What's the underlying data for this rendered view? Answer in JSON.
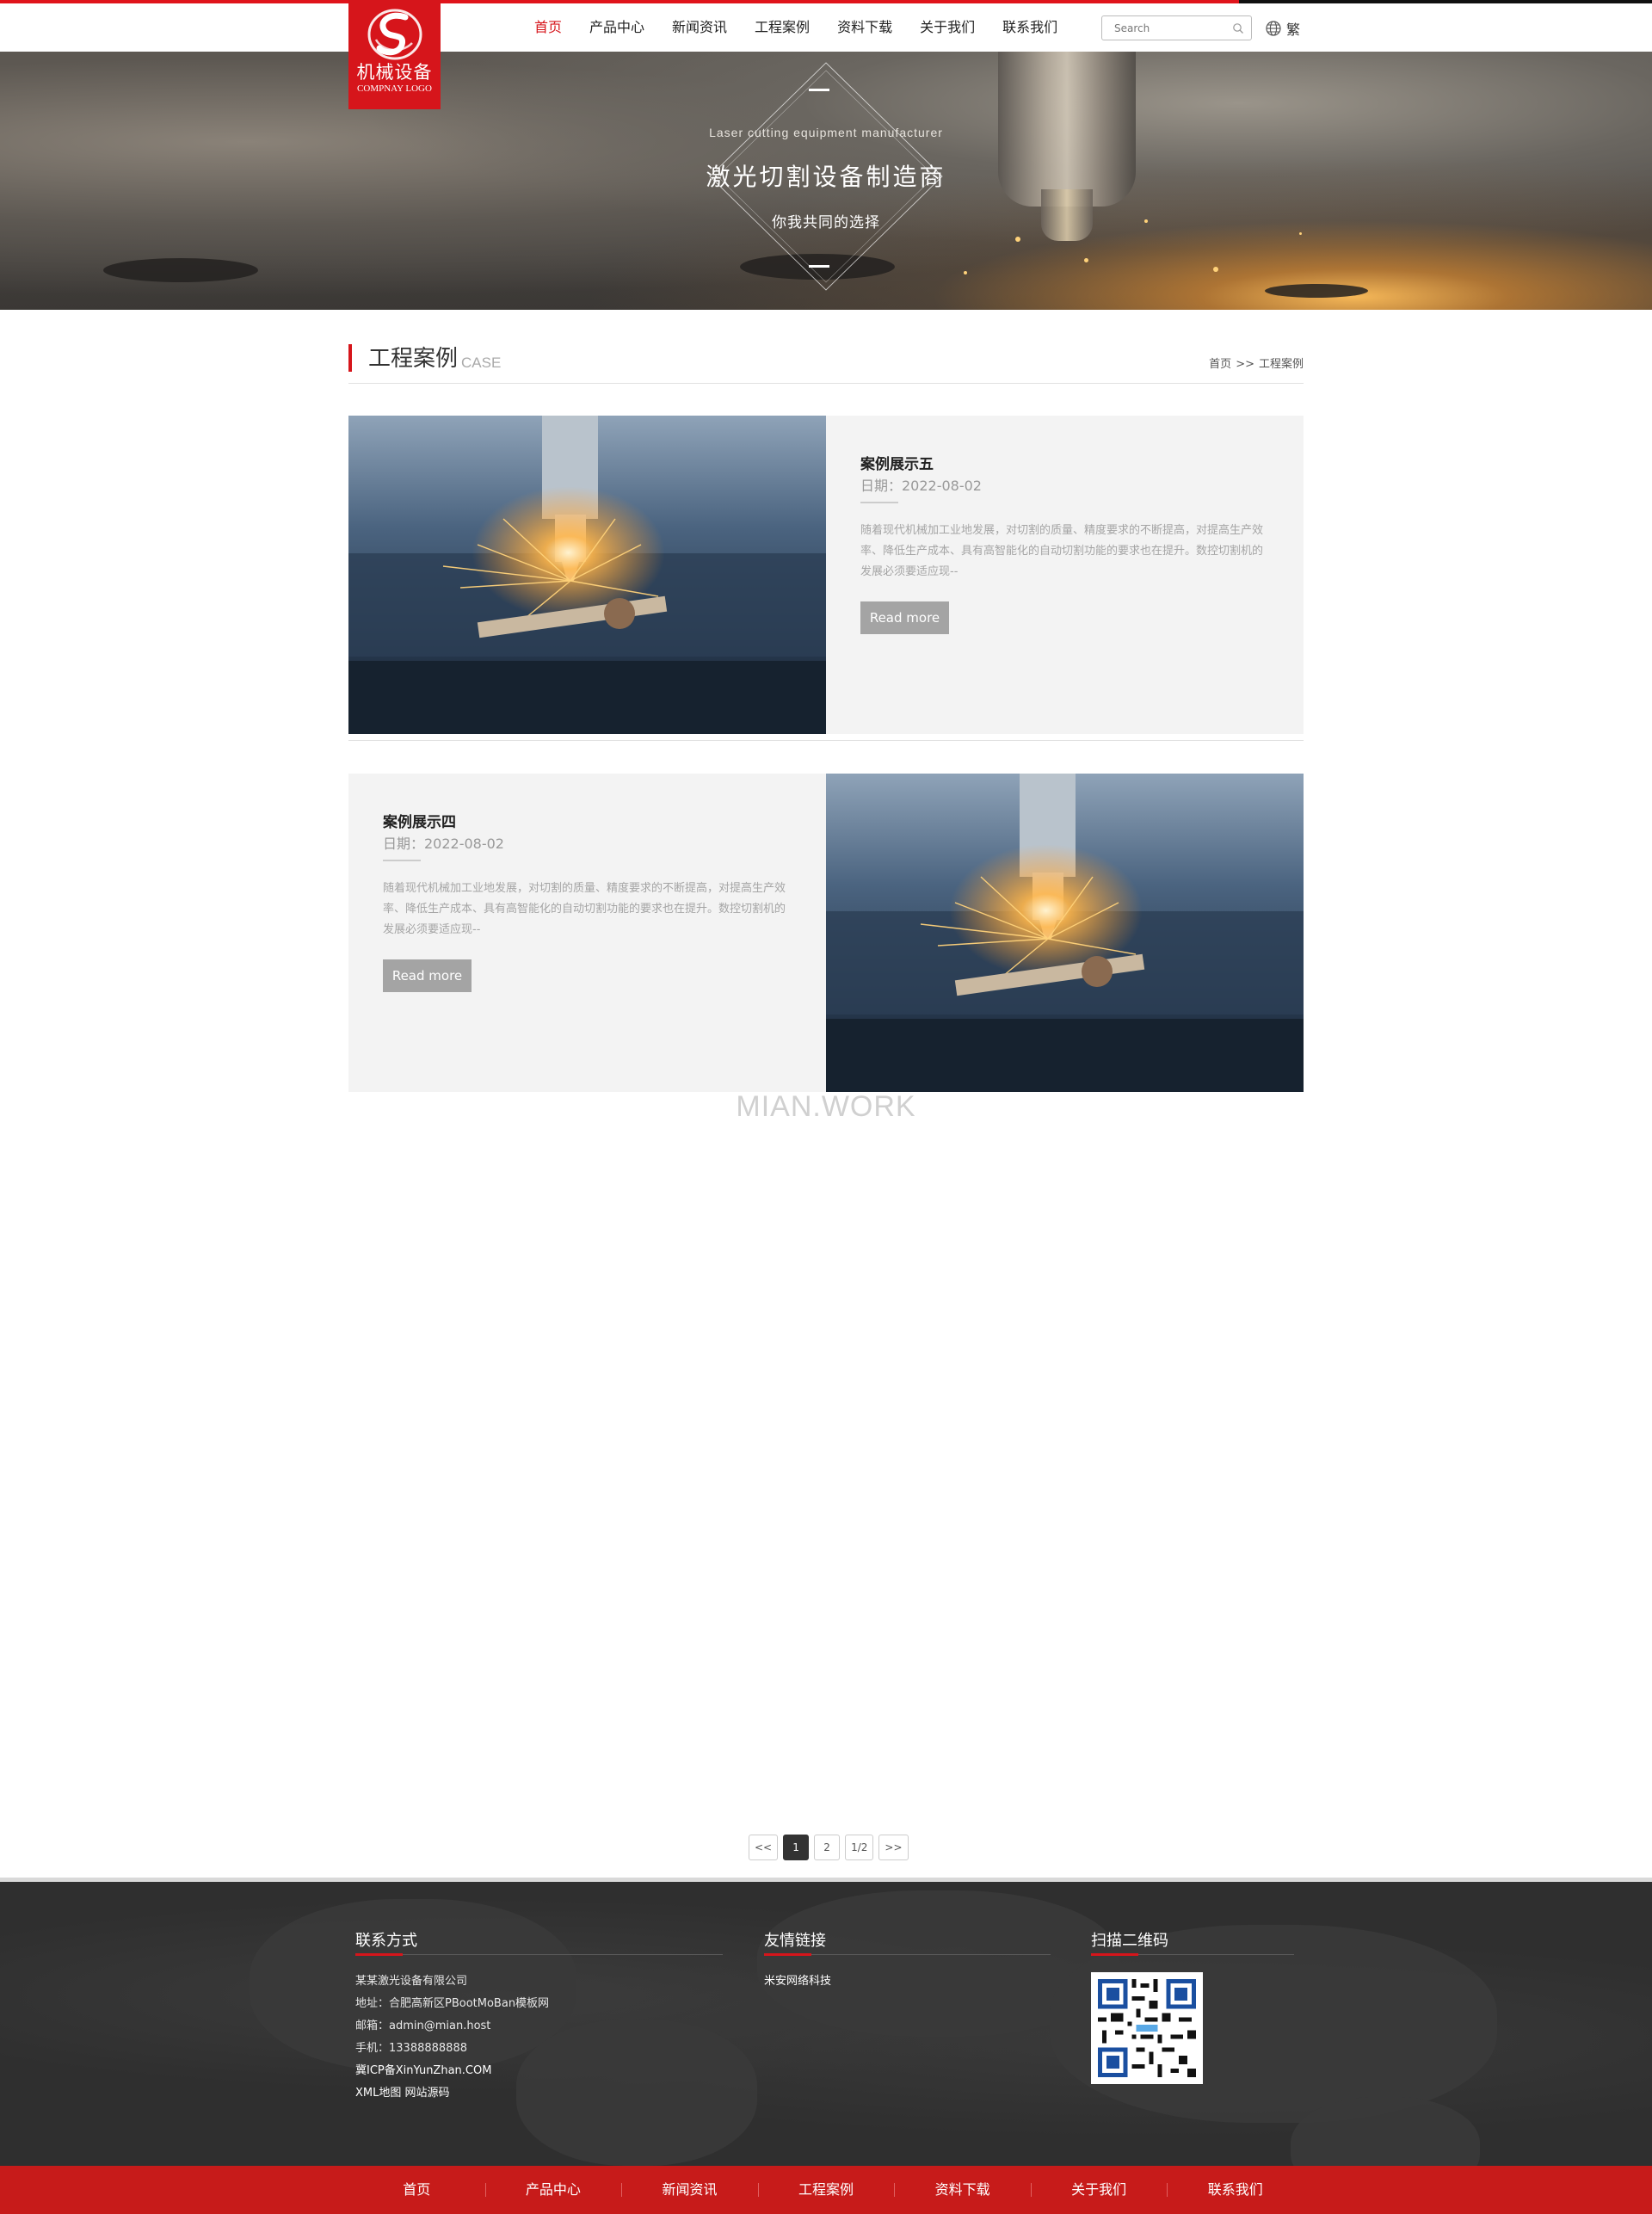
{
  "colors": {
    "brand_red": "#d6151b",
    "footer_bg": "#2f2f2f",
    "bottom_bar": "#c71b1a"
  },
  "logo": {
    "brand": "机械设备",
    "sub": "COMPNAY LOGO"
  },
  "nav": [
    {
      "label": "首页",
      "active": true
    },
    {
      "label": "产品中心"
    },
    {
      "label": "新闻资讯"
    },
    {
      "label": "工程案例"
    },
    {
      "label": "资料下载"
    },
    {
      "label": "关于我们"
    },
    {
      "label": "联系我们"
    }
  ],
  "search": {
    "placeholder": "Search",
    "icon": "search-icon"
  },
  "lang": {
    "icon": "globe-icon",
    "label": "繁"
  },
  "banner": {
    "en": "Laser cutting equipment manufacturer",
    "zh": "激光切割设备制造商",
    "tagline": "你我共同的选择"
  },
  "section": {
    "title": "工程案例",
    "title_en": "CASE",
    "breadcrumb": {
      "home": "首页",
      "sep": ">>",
      "current": "工程案例"
    }
  },
  "cases": [
    {
      "title": "案例展示五",
      "date": "日期：2022-08-02",
      "desc": "随着现代机械加工业地发展，对切割的质量、精度要求的不断提高，对提高生产效率、降低生产成本、具有高智能化的自动切割功能的要求也在提升。数控切割机的发展必须要适应现--",
      "more": "Read more"
    },
    {
      "title": "案例展示四",
      "date": "日期：2022-08-02",
      "desc": "随着现代机械加工业地发展，对切割的质量、精度要求的不断提高，对提高生产效率、降低生产成本、具有高智能化的自动切割功能的要求也在提升。数控切割机的发展必须要适应现--",
      "more": "Read more"
    }
  ],
  "watermark": "MIAN.WORK",
  "pager": {
    "prev": "<<",
    "pages": [
      "1",
      "2"
    ],
    "current": "1",
    "total": "1/2",
    "next": ">>"
  },
  "footer": {
    "contact": {
      "title": "联系方式",
      "company": "某某激光设备有限公司",
      "address": "地址：合肥高新区PBootMoBan模板网",
      "email": "邮箱：admin@mian.host",
      "phone": "手机：13388888888",
      "icp": "冀ICP备XinYunZhan.COM",
      "sitemap": "XML地图",
      "source": "网站源码"
    },
    "links": {
      "title": "友情链接",
      "items": [
        "米安网络科技"
      ]
    },
    "qr": {
      "title": "扫描二维码"
    }
  },
  "bottom_nav": [
    "首页",
    "产品中心",
    "新闻资讯",
    "工程案例",
    "资料下载",
    "关于我们",
    "联系我们"
  ]
}
